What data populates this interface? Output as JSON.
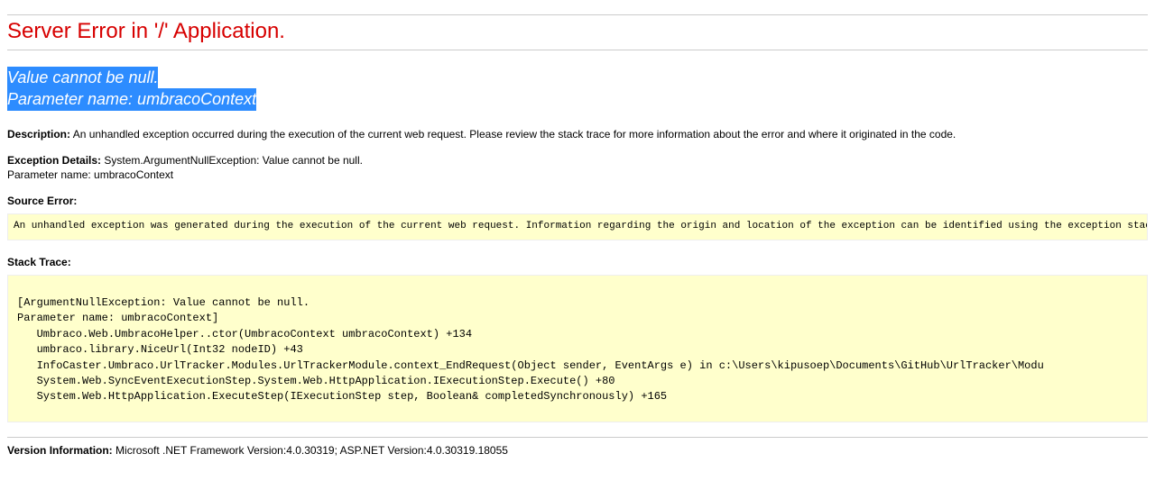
{
  "title": "Server Error in '/' Application.",
  "error_message": {
    "line1": "Value cannot be null.",
    "line2": "Parameter name: umbracoContext"
  },
  "description": {
    "label": "Description:",
    "text": "An unhandled exception occurred during the execution of the current web request. Please review the stack trace for more information about the error and where it originated in the code."
  },
  "exception_details": {
    "label": "Exception Details:",
    "text": "System.ArgumentNullException: Value cannot be null.",
    "text2": "Parameter name: umbracoContext"
  },
  "source_error": {
    "label": "Source Error:",
    "text": "An unhandled exception was generated during the execution of the current web request. Information regarding the origin and location of the exception can be identified using the exception stack trace below."
  },
  "stack_trace": {
    "label": "Stack Trace:",
    "text": "[ArgumentNullException: Value cannot be null.\nParameter name: umbracoContext]\n   Umbraco.Web.UmbracoHelper..ctor(UmbracoContext umbracoContext) +134\n   umbraco.library.NiceUrl(Int32 nodeID) +43\n   InfoCaster.Umbraco.UrlTracker.Modules.UrlTrackerModule.context_EndRequest(Object sender, EventArgs e) in c:\\Users\\kipusoep\\Documents\\GitHub\\UrlTracker\\Modu\n   System.Web.SyncEventExecutionStep.System.Web.HttpApplication.IExecutionStep.Execute() +80\n   System.Web.HttpApplication.ExecuteStep(IExecutionStep step, Boolean& completedSynchronously) +165"
  },
  "version": {
    "label": "Version Information:",
    "text": "Microsoft .NET Framework Version:4.0.30319; ASP.NET Version:4.0.30319.18055"
  }
}
